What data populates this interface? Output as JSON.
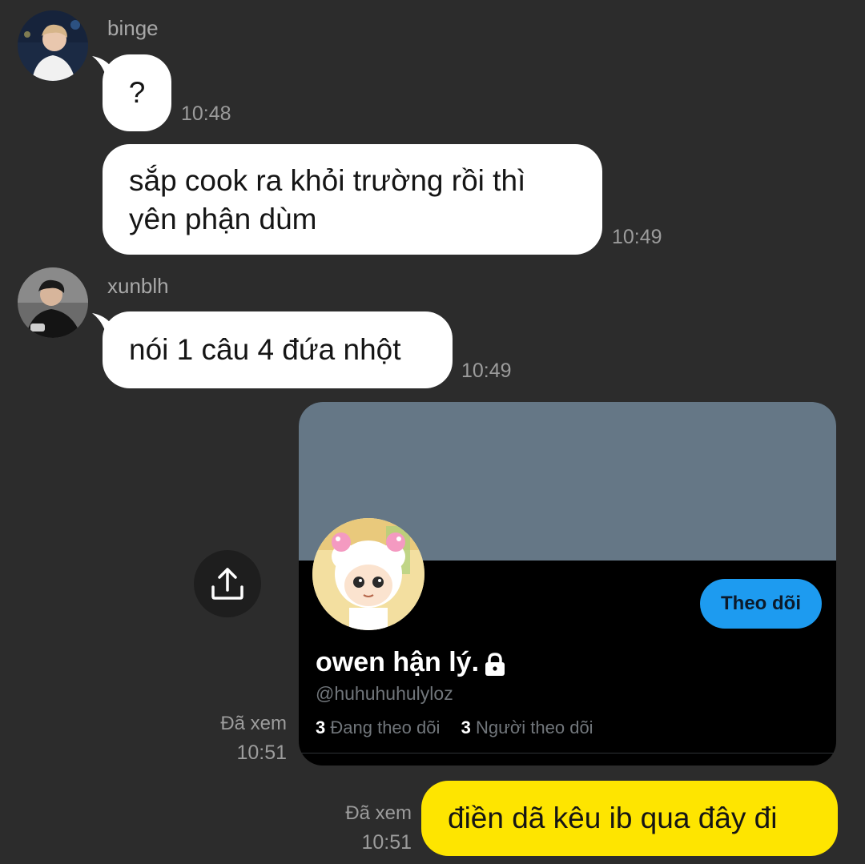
{
  "messages": [
    {
      "sender": "binge",
      "text": "?",
      "time": "10:48"
    },
    {
      "text_lines": [
        "sắp cook ra khỏi trường rồi thì",
        "yên phận dùm"
      ],
      "time": "10:49"
    },
    {
      "sender": "xunblh",
      "text": "nói 1 câu 4 đứa nhột",
      "time": "10:49"
    }
  ],
  "shared_profile": {
    "display_name": "owen hận lý.",
    "handle": "@huhuhuhulyloz",
    "following_count": "3",
    "following_label": "Đang theo dõi",
    "followers_count": "3",
    "followers_label": "Người theo dõi",
    "follow_button": "Theo dõi",
    "seen_label": "Đã xem",
    "time": "10:51",
    "banner_color": "#657786",
    "button_color": "#1d9bf0"
  },
  "last_message": {
    "text": "điền dã kêu ib qua đây đi",
    "seen_label": "Đã xem",
    "time": "10:51",
    "bubble_color": "#fee500"
  },
  "icons": {
    "share": "share-upload-icon",
    "lock": "lock-icon"
  }
}
